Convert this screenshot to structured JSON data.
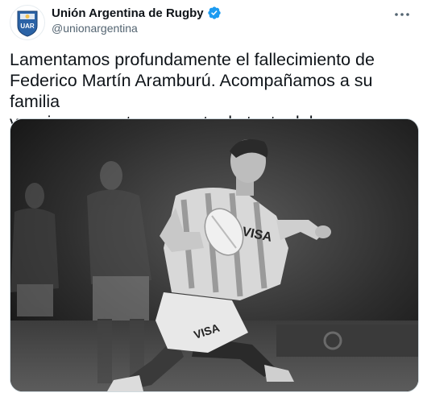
{
  "tweet": {
    "display_name": "Unión Argentina de Rugby",
    "handle": "@unionargentina",
    "avatar_label": "UAR",
    "text": "Lamentamos profundamente el fallecimiento de\nFederico Martín Aramburú. Acompañamos a su familia\ny amigos en este momento de tanto dolor.",
    "media": {
      "jersey_text": "VISA",
      "shorts_text": "VISA"
    }
  },
  "icons": {
    "verified": "verified-badge-icon",
    "more": "more-options-icon"
  },
  "colors": {
    "verified_blue": "#1d9bf0",
    "avatar_blue": "#2b63a6"
  }
}
